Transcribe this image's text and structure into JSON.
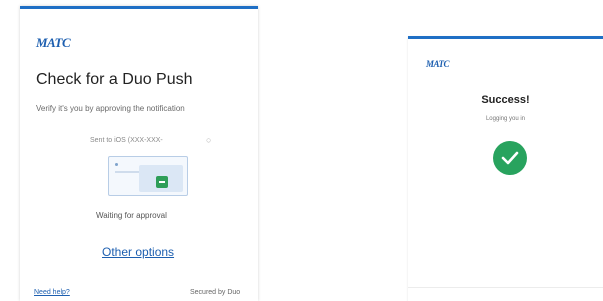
{
  "left_panel": {
    "logo_text": "MATC",
    "title": "Check for a Duo Push",
    "subtitle": "Verify it's you by approving the notification",
    "sent_to": "Sent to iOS (XXX-XXX-",
    "status": "Waiting for approval",
    "other_options": "Other options",
    "need_help": "Need help?",
    "secured_by": "Secured by Duo"
  },
  "right_panel": {
    "logo_text": "MATC",
    "success_title": "Success!",
    "logging_in": "Logging you in"
  },
  "colors": {
    "accent": "#1f6fc5",
    "link": "#1d5fb0",
    "success": "#28a35e"
  }
}
